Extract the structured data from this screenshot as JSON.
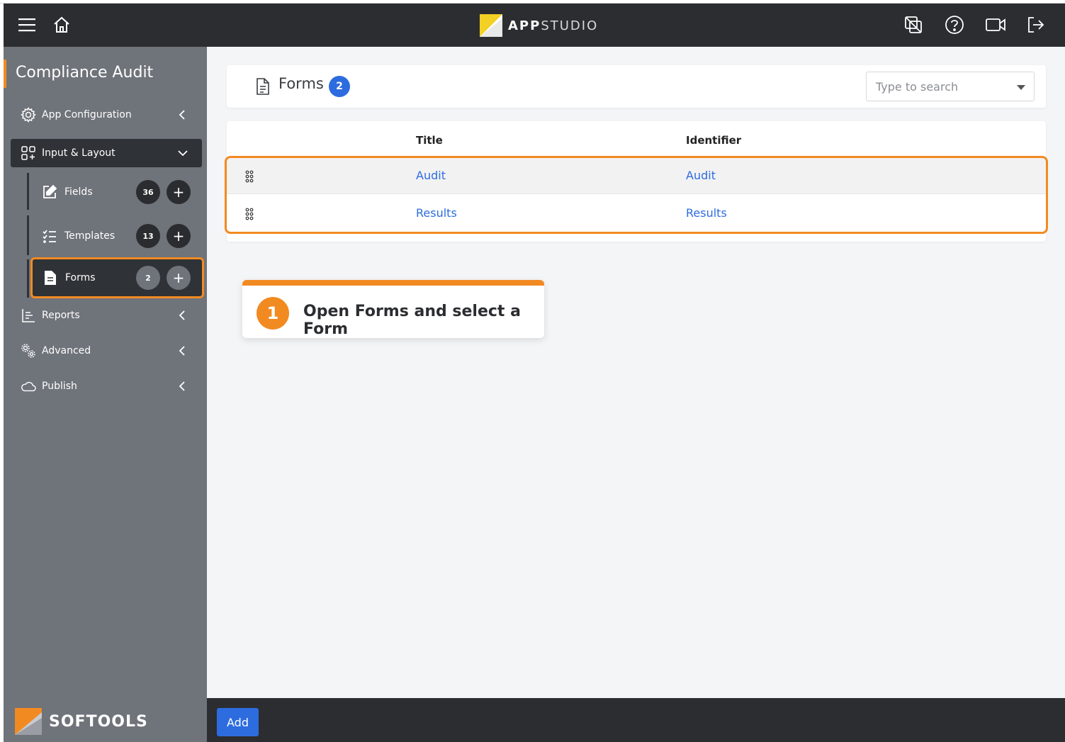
{
  "brand": {
    "part1": "APP",
    "part2": "STUDIO"
  },
  "sidebar": {
    "app_title": "Compliance Audit",
    "items": [
      {
        "label": "App Configuration",
        "icon": "gear-icon"
      },
      {
        "label": "Input & Layout",
        "icon": "layout-icon"
      },
      {
        "label": "Reports",
        "icon": "reports-icon"
      },
      {
        "label": "Advanced",
        "icon": "gears-icon"
      },
      {
        "label": "Publish",
        "icon": "cloud-icon"
      }
    ],
    "sub_items": [
      {
        "label": "Fields",
        "count": "36",
        "icon": "edit-icon"
      },
      {
        "label": "Templates",
        "count": "13",
        "icon": "list-icon"
      },
      {
        "label": "Forms",
        "count": "2",
        "icon": "document-icon"
      }
    ],
    "footer_brand": "SOFTOOLS"
  },
  "main": {
    "title": "Forms",
    "count": "2",
    "search_placeholder": "Type to search",
    "columns": [
      "Title",
      "Identifier"
    ],
    "rows": [
      {
        "title": "Audit",
        "identifier": "Audit"
      },
      {
        "title": "Results",
        "identifier": "Results"
      }
    ]
  },
  "callout": {
    "step": "1",
    "text": "Open Forms and select a Form"
  },
  "footer": {
    "add_label": "Add"
  },
  "colors": {
    "accent": "#f28a22",
    "link": "#2d6cdf",
    "dark": "#2b2d30",
    "sidebar": "#6f737a"
  }
}
